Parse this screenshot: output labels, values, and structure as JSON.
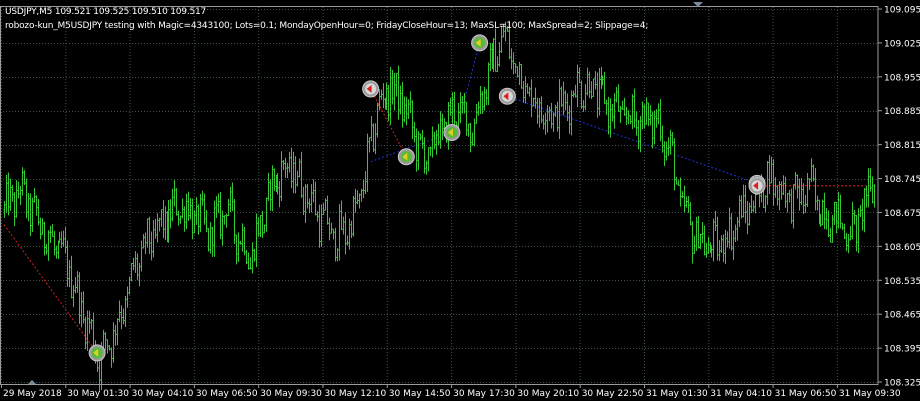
{
  "header": {
    "symbol_line": "USDJPY,M5  109.521 109.525 109.510 109.517",
    "ea_line": "robozo-kun_M5USDJPY testing with Magic=4343100; Lots=0.1; MondayOpenHour=0; FridayCloseHour=13; MaxSL=100; MaxSpread=2; Slippage=4;"
  },
  "colors": {
    "background": "#000000",
    "grid": "#3d4f4f",
    "candles": "#35c835",
    "frame": "#9a9a9a",
    "text": "#ffffff",
    "axis_text": "#ffffff",
    "trade_line_loss": "#d42020",
    "trade_line_win": "#2030d8",
    "marker_gray": "#9a9a9a",
    "marker_buy": "#e0d020",
    "marker_sell": "#e02020"
  },
  "chart_data": {
    "type": "candlestick",
    "symbol": "USDJPY",
    "timeframe": "M5",
    "ylim": [
      108.325,
      109.095
    ],
    "y_ticks": [
      "109.095",
      "109.025",
      "108.955",
      "108.885",
      "108.815",
      "108.745",
      "108.675",
      "108.605",
      "108.535",
      "108.465",
      "108.395",
      "108.325"
    ],
    "x_ticks": [
      "29 May 2018",
      "30 May 01:30",
      "30 May 04:10",
      "30 May 06:50",
      "30 May 09:30",
      "30 May 12:10",
      "30 May 14:50",
      "30 May 17:30",
      "30 May 20:10",
      "30 May 22:50",
      "31 May 01:30",
      "31 May 04:10",
      "31 May 06:50",
      "31 May 09:30"
    ],
    "bar_count": 440,
    "grid": true,
    "price_path": [
      [
        0,
        108.68
      ],
      [
        8,
        108.72
      ],
      [
        16,
        108.66
      ],
      [
        24,
        108.61
      ],
      [
        32,
        108.57
      ],
      [
        38,
        108.49
      ],
      [
        44,
        108.42
      ],
      [
        48,
        108.37
      ],
      [
        54,
        108.42
      ],
      [
        60,
        108.48
      ],
      [
        66,
        108.56
      ],
      [
        72,
        108.61
      ],
      [
        80,
        108.65
      ],
      [
        88,
        108.69
      ],
      [
        96,
        108.67
      ],
      [
        104,
        108.63
      ],
      [
        112,
        108.69
      ],
      [
        118,
        108.63
      ],
      [
        124,
        108.58
      ],
      [
        130,
        108.66
      ],
      [
        136,
        108.74
      ],
      [
        144,
        108.77
      ],
      [
        152,
        108.72
      ],
      [
        160,
        108.66
      ],
      [
        168,
        108.62
      ],
      [
        176,
        108.66
      ],
      [
        182,
        108.75
      ],
      [
        188,
        108.89
      ],
      [
        194,
        108.93
      ],
      [
        200,
        108.91
      ],
      [
        206,
        108.85
      ],
      [
        212,
        108.78
      ],
      [
        220,
        108.84
      ],
      [
        228,
        108.89
      ],
      [
        236,
        108.85
      ],
      [
        244,
        108.96
      ],
      [
        252,
        109.04
      ],
      [
        258,
        108.98
      ],
      [
        266,
        108.91
      ],
      [
        274,
        108.88
      ],
      [
        282,
        108.89
      ],
      [
        290,
        108.94
      ],
      [
        298,
        108.93
      ],
      [
        306,
        108.89
      ],
      [
        314,
        108.87
      ],
      [
        322,
        108.87
      ],
      [
        330,
        108.86
      ],
      [
        336,
        108.8
      ],
      [
        342,
        108.68
      ],
      [
        348,
        108.63
      ],
      [
        356,
        108.6
      ],
      [
        364,
        108.62
      ],
      [
        372,
        108.67
      ],
      [
        380,
        108.71
      ],
      [
        386,
        108.75
      ],
      [
        392,
        108.72
      ],
      [
        400,
        108.7
      ],
      [
        406,
        108.73
      ],
      [
        412,
        108.68
      ],
      [
        420,
        108.66
      ],
      [
        428,
        108.63
      ],
      [
        434,
        108.69
      ],
      [
        439,
        108.74
      ]
    ],
    "trades": [
      {
        "open_bar": 0,
        "open_price": 108.65,
        "close_bar": 47,
        "close_price": 108.385,
        "result": "loss",
        "close_arrow": "left"
      },
      {
        "open_bar": 185,
        "open_price": 108.93,
        "close_bar": 203,
        "close_price": 108.79,
        "result": "loss",
        "open_marker": "sell",
        "close_arrow": "left"
      },
      {
        "open_bar": 185,
        "open_price": 108.78,
        "close_bar": 226,
        "close_price": 108.84,
        "result": "win",
        "close_arrow": "left"
      },
      {
        "open_bar": 228,
        "open_price": 108.84,
        "close_bar": 240,
        "close_price": 109.025,
        "result": "win",
        "close_arrow": "left"
      },
      {
        "open_bar": 254,
        "open_price": 108.915,
        "close_bar": 380,
        "close_price": 108.735,
        "result": "win",
        "open_marker": "sell",
        "close_arrow": "left"
      },
      {
        "open_bar": 380,
        "open_price": 108.73,
        "close_bar": 439,
        "close_price": 108.73,
        "result": "loss",
        "open_marker": "sell"
      }
    ]
  }
}
